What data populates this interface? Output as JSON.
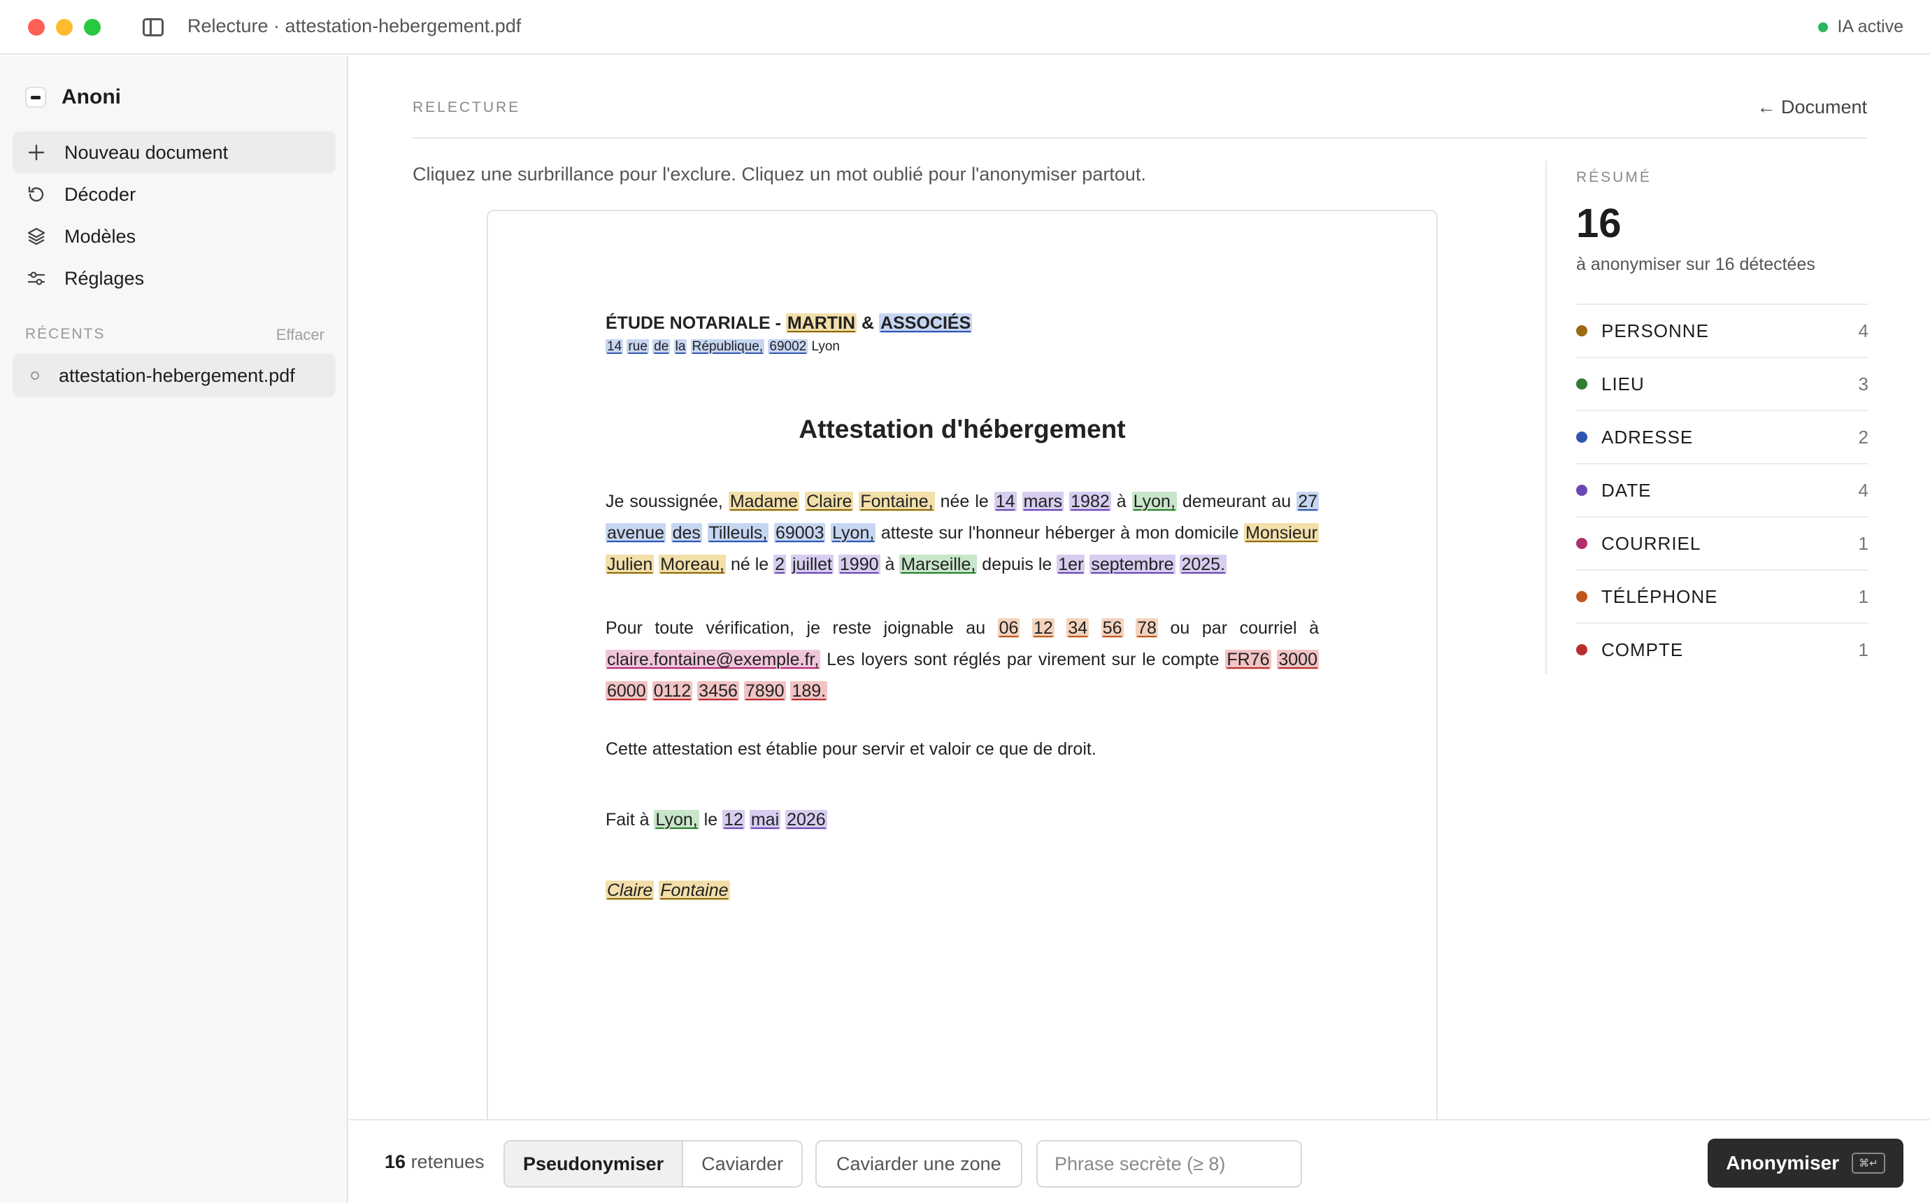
{
  "window": {
    "title": "Relecture · attestation-hebergement.pdf",
    "ai_status": "IA active"
  },
  "sidebar": {
    "brand": "Anoni",
    "items": [
      {
        "label": "Nouveau document",
        "icon": "plus-icon"
      },
      {
        "label": "Décoder",
        "icon": "history-icon"
      },
      {
        "label": "Modèles",
        "icon": "layers-icon"
      },
      {
        "label": "Réglages",
        "icon": "sliders-icon"
      }
    ],
    "recents_label": "RÉCENTS",
    "clear_label": "Effacer",
    "recents": [
      "attestation-hebergement.pdf"
    ]
  },
  "main": {
    "section_label": "RELECTURE",
    "back_label": "← Document",
    "hint": "Cliquez une surbrillance pour l'exclure. Cliquez un mot oublié pour l'anonymiser partout."
  },
  "document": {
    "firm": [
      {
        "t": "ÉTUDE NOTARIALE - "
      },
      {
        "t": "MARTIN",
        "c": "hp"
      },
      {
        "t": " & "
      },
      {
        "t": "ASSOCIÉS",
        "c": "ha"
      }
    ],
    "firm_address": [
      {
        "t": "14",
        "c": "ha"
      },
      {
        "t": " "
      },
      {
        "t": "rue",
        "c": "ha"
      },
      {
        "t": " "
      },
      {
        "t": "de",
        "c": "ha"
      },
      {
        "t": " "
      },
      {
        "t": "la",
        "c": "ha"
      },
      {
        "t": " "
      },
      {
        "t": "République,",
        "c": "ha"
      },
      {
        "t": " "
      },
      {
        "t": "69002",
        "c": "ha"
      },
      {
        "t": " Lyon"
      }
    ],
    "title": "Attestation d'hébergement",
    "paragraph1": [
      {
        "t": "Je soussignée, "
      },
      {
        "t": "Madame",
        "c": "hp"
      },
      {
        "t": " "
      },
      {
        "t": "Claire",
        "c": "hp"
      },
      {
        "t": " "
      },
      {
        "t": "Fontaine,",
        "c": "hp"
      },
      {
        "t": " née le "
      },
      {
        "t": "14",
        "c": "hd"
      },
      {
        "t": " "
      },
      {
        "t": "mars",
        "c": "hd"
      },
      {
        "t": " "
      },
      {
        "t": "1982",
        "c": "hd"
      },
      {
        "t": " à "
      },
      {
        "t": "Lyon,",
        "c": "hl"
      },
      {
        "t": " demeurant au "
      },
      {
        "t": "27",
        "c": "ha"
      },
      {
        "t": " "
      },
      {
        "t": "avenue",
        "c": "ha"
      },
      {
        "t": " "
      },
      {
        "t": "des",
        "c": "ha"
      },
      {
        "t": " "
      },
      {
        "t": "Tilleuls,",
        "c": "ha"
      },
      {
        "t": " "
      },
      {
        "t": "69003",
        "c": "ha"
      },
      {
        "t": " "
      },
      {
        "t": "Lyon,",
        "c": "ha"
      },
      {
        "t": " atteste sur l'honneur héberger à mon domicile "
      },
      {
        "t": "Monsieur",
        "c": "hp"
      },
      {
        "t": " "
      },
      {
        "t": "Julien",
        "c": "hp"
      },
      {
        "t": " "
      },
      {
        "t": "Moreau,",
        "c": "hp"
      },
      {
        "t": " né le "
      },
      {
        "t": "2",
        "c": "hd"
      },
      {
        "t": " "
      },
      {
        "t": "juillet",
        "c": "hd"
      },
      {
        "t": " "
      },
      {
        "t": "1990",
        "c": "hd"
      },
      {
        "t": " à "
      },
      {
        "t": "Marseille,",
        "c": "hl"
      },
      {
        "t": " depuis le "
      },
      {
        "t": "1er",
        "c": "hd"
      },
      {
        "t": " "
      },
      {
        "t": "septembre",
        "c": "hd"
      },
      {
        "t": " "
      },
      {
        "t": "2025.",
        "c": "hd"
      }
    ],
    "paragraph2": [
      {
        "t": "Pour toute vérification, je reste joignable au "
      },
      {
        "t": "06",
        "c": "ht"
      },
      {
        "t": " "
      },
      {
        "t": "12",
        "c": "ht"
      },
      {
        "t": " "
      },
      {
        "t": "34",
        "c": "ht"
      },
      {
        "t": " "
      },
      {
        "t": "56",
        "c": "ht"
      },
      {
        "t": " "
      },
      {
        "t": "78",
        "c": "ht"
      },
      {
        "t": " ou par courriel à "
      },
      {
        "t": "claire.fontaine@exemple.fr,",
        "c": "hm"
      },
      {
        "t": " Les loyers sont réglés par virement sur le compte "
      },
      {
        "t": "FR76",
        "c": "hc"
      },
      {
        "t": " "
      },
      {
        "t": "3000",
        "c": "hc"
      },
      {
        "t": " "
      },
      {
        "t": "6000",
        "c": "hc"
      },
      {
        "t": " "
      },
      {
        "t": "0112",
        "c": "hc"
      },
      {
        "t": " "
      },
      {
        "t": "3456",
        "c": "hc"
      },
      {
        "t": " "
      },
      {
        "t": "7890",
        "c": "hc"
      },
      {
        "t": " "
      },
      {
        "t": "189.",
        "c": "hc"
      }
    ],
    "closing": "Cette attestation est établie pour servir et valoir ce que de droit.",
    "place_date": [
      {
        "t": "Fait à "
      },
      {
        "t": "Lyon,",
        "c": "hl"
      },
      {
        "t": " le "
      },
      {
        "t": "12",
        "c": "hd"
      },
      {
        "t": " "
      },
      {
        "t": "mai",
        "c": "hd"
      },
      {
        "t": " "
      },
      {
        "t": "2026",
        "c": "hd"
      }
    ],
    "signature": [
      {
        "t": "Claire",
        "c": "hp"
      },
      {
        "t": " "
      },
      {
        "t": "Fontaine",
        "c": "hp"
      }
    ]
  },
  "summary": {
    "label": "RÉSUMÉ",
    "total": "16",
    "subtitle": "à anonymiser sur 16 détectées",
    "categories": [
      {
        "name": "PERSONNE",
        "count": "4",
        "color": "#9a6b12"
      },
      {
        "name": "LIEU",
        "count": "3",
        "color": "#2e7d32"
      },
      {
        "name": "ADRESSE",
        "count": "2",
        "color": "#2f55b0"
      },
      {
        "name": "DATE",
        "count": "4",
        "color": "#6a48b5"
      },
      {
        "name": "COURRIEL",
        "count": "1",
        "color": "#b0306e"
      },
      {
        "name": "TÉLÉPHONE",
        "count": "1",
        "color": "#c0571c"
      },
      {
        "name": "COMPTE",
        "count": "1",
        "color": "#b92e2e"
      }
    ]
  },
  "bottom": {
    "retained_count": "16",
    "retained_label": "retenues",
    "mode_pseudo": "Pseudonymiser",
    "mode_redact": "Caviarder",
    "zone_button": "Caviarder une zone",
    "passphrase_placeholder": "Phrase secrète (≥ 8)",
    "primary_button": "Anonymiser",
    "shortcut": "⌘↵"
  }
}
